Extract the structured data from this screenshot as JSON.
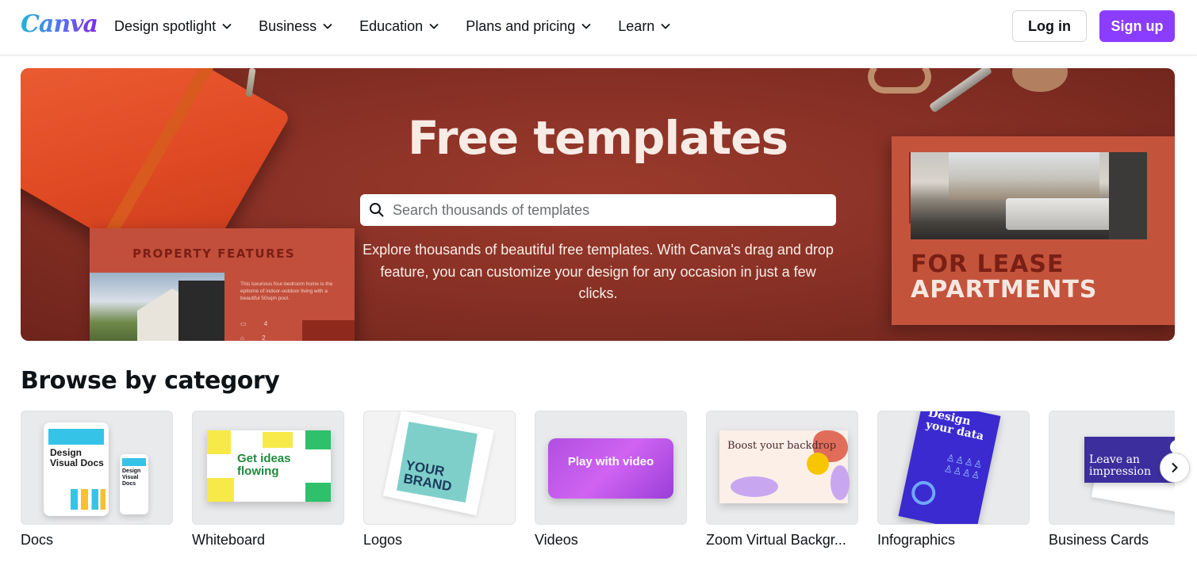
{
  "header": {
    "logo": "Canva",
    "nav": [
      {
        "label": "Design spotlight"
      },
      {
        "label": "Business"
      },
      {
        "label": "Education"
      },
      {
        "label": "Plans and pricing"
      },
      {
        "label": "Learn"
      }
    ],
    "login_label": "Log in",
    "signup_label": "Sign up"
  },
  "hero": {
    "title": "Free templates",
    "search_placeholder": "Search thousands of templates",
    "subtitle": "Explore thousands of beautiful free templates. With Canva's drag and drop feature, you can customize your design for any occasion in just a few clicks.",
    "left_card": {
      "title": "PROPERTY FEATURES",
      "body": "This luxurious four-bedroom home is the epitome of indoor-outdoor living with a beautiful 50sqm pool.",
      "stat1": "4",
      "stat2": "2"
    },
    "right_card": {
      "line1": "FOR LEASE",
      "line2": "APARTMENTS"
    }
  },
  "browse": {
    "title": "Browse by category",
    "categories": [
      {
        "label": "Docs",
        "thumb_text": "Design Visual Docs"
      },
      {
        "label": "Whiteboard",
        "thumb_text": "Get ideas flowing"
      },
      {
        "label": "Logos",
        "thumb_text": "YOUR BRAND"
      },
      {
        "label": "Videos",
        "thumb_text": "Play with video"
      },
      {
        "label": "Zoom Virtual Backgr...",
        "thumb_text": "Boost your backdrop"
      },
      {
        "label": "Infographics",
        "thumb_text": "Design your data"
      },
      {
        "label": "Business Cards",
        "thumb_text": "Leave an impression"
      }
    ]
  },
  "colors": {
    "brand_purple": "#8b3dff",
    "hero_bg": "#8a3126",
    "text": "#0e1318"
  }
}
